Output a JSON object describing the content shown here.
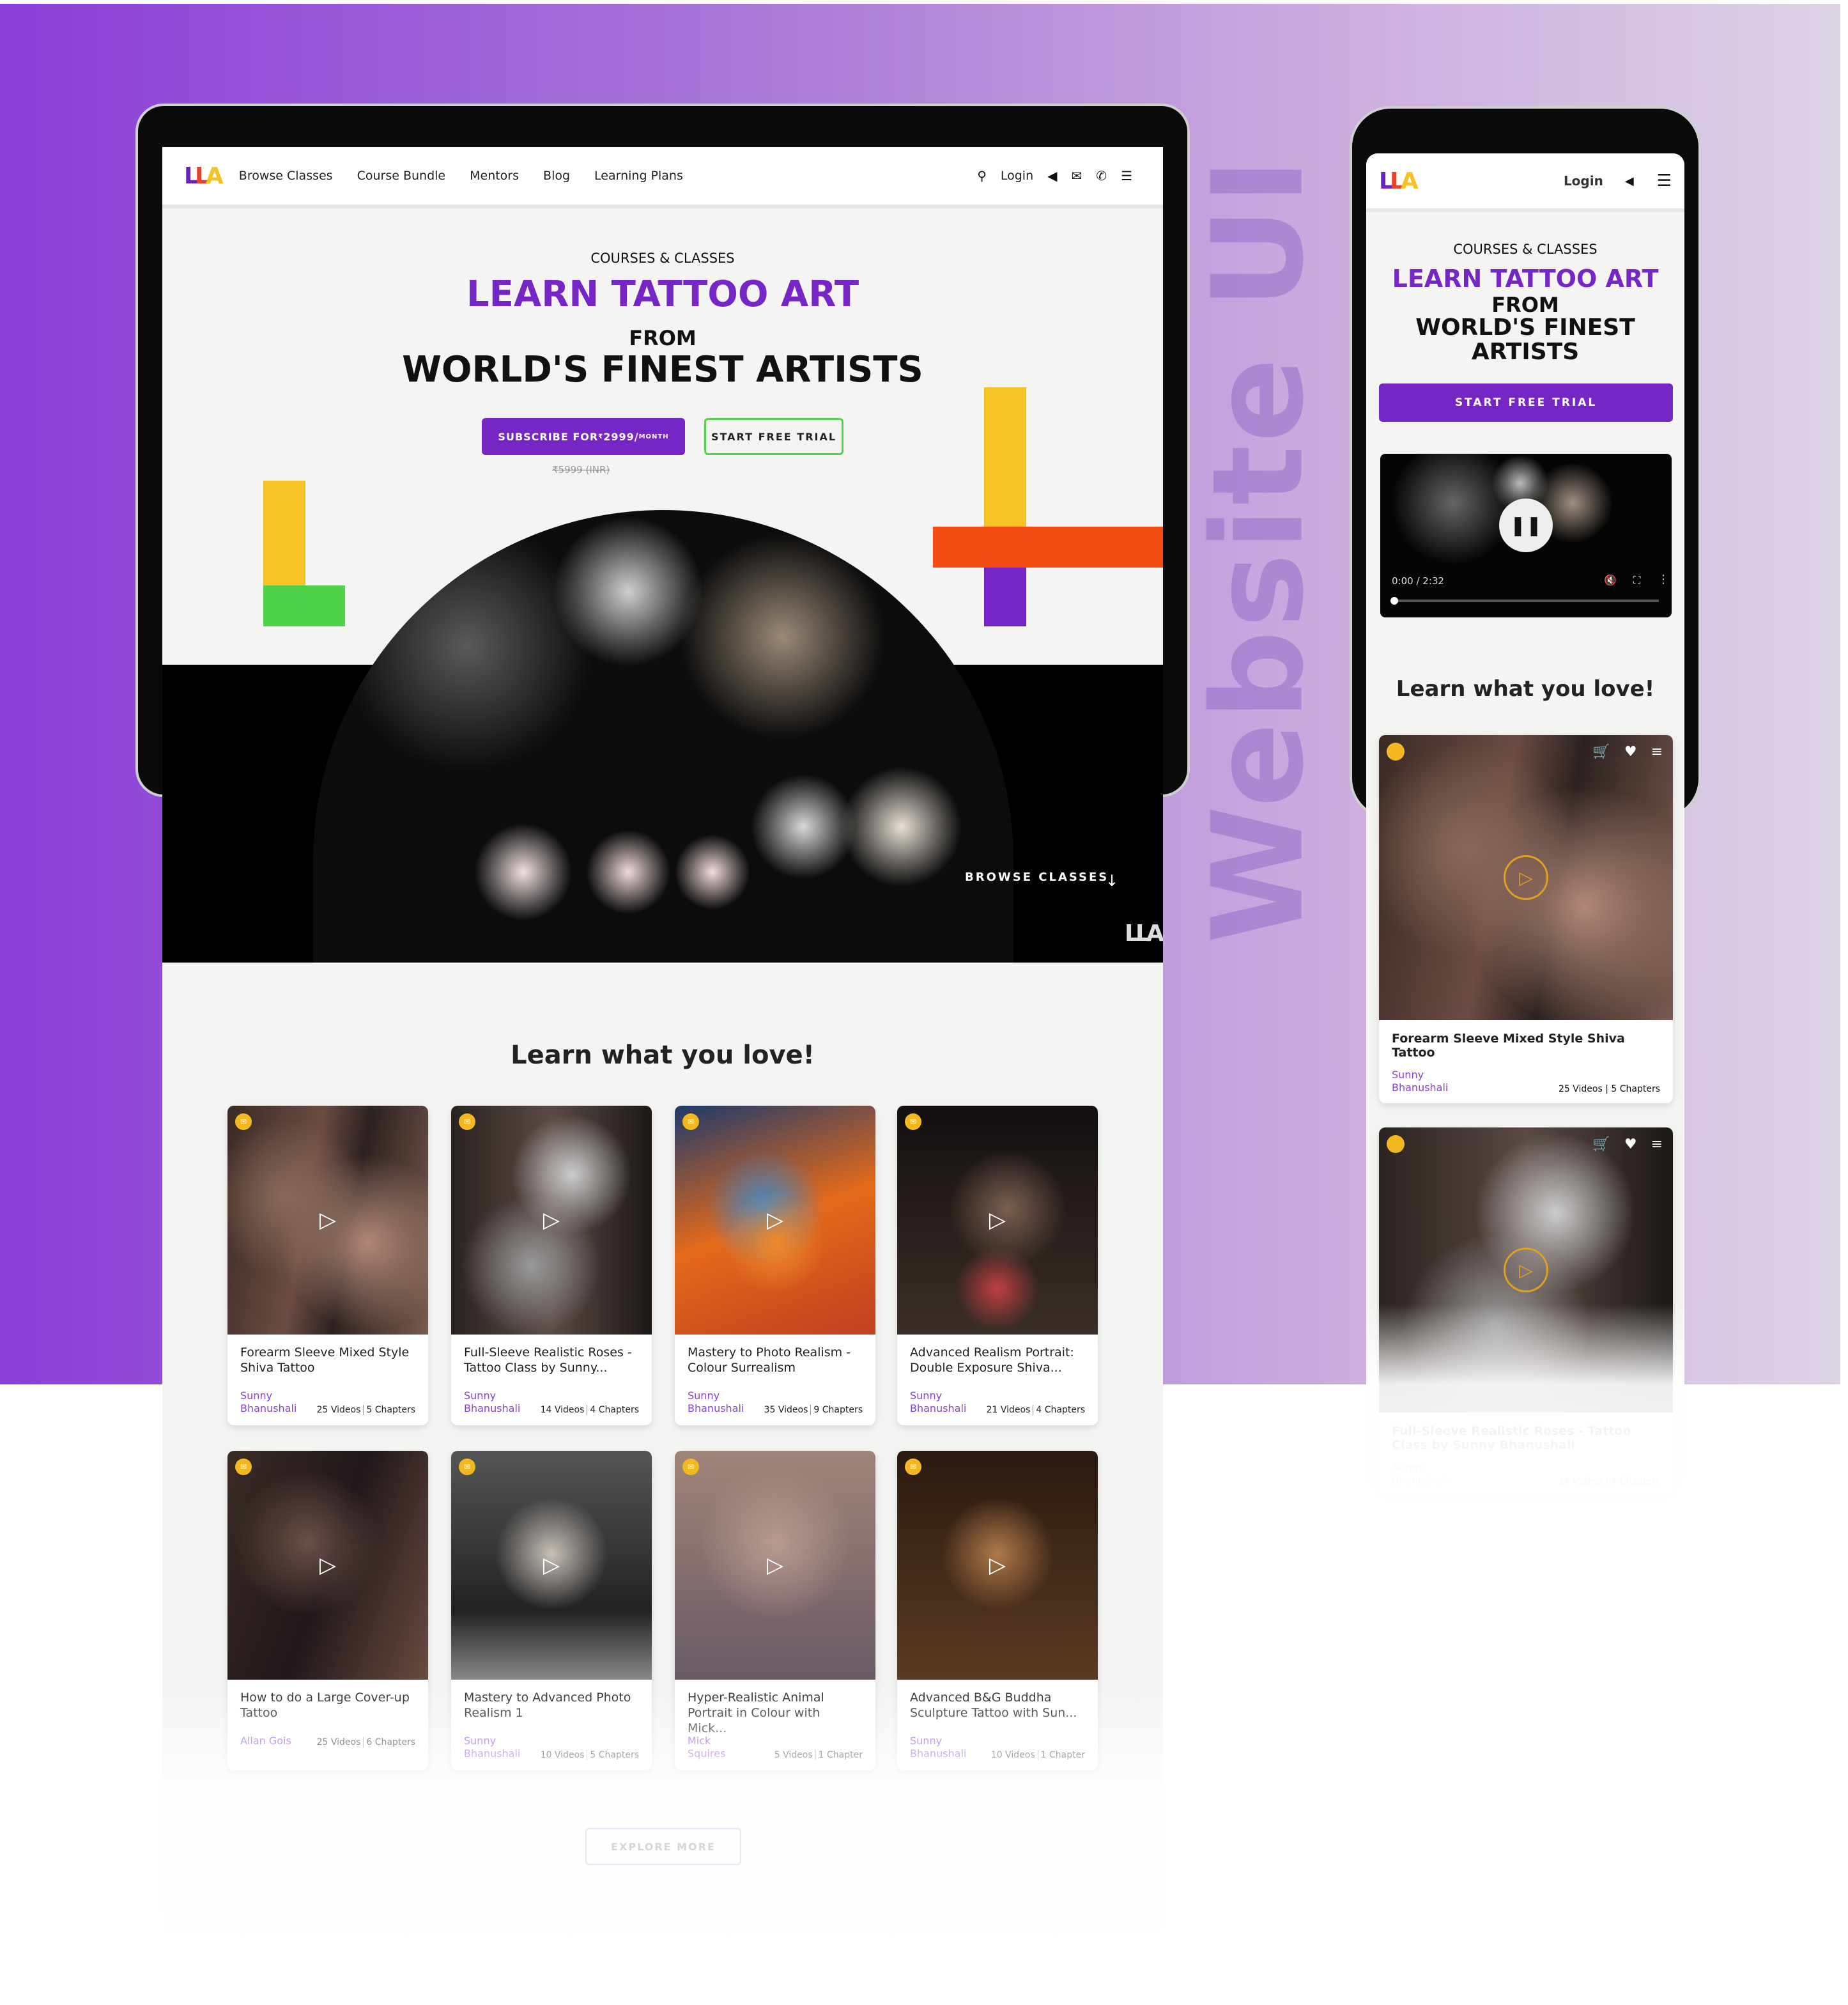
{
  "decor": {
    "side_title": "Website UI",
    "colors": {
      "purple": "#7526c4",
      "yellow": "#f5c326",
      "green": "#4fd14a",
      "orange": "#f44d12"
    }
  },
  "desktop": {
    "nav": {
      "logo": "LLA",
      "links": [
        "Browse Classes",
        "Course Bundle",
        "Mentors",
        "Blog",
        "Learning Plans"
      ],
      "login": "Login",
      "icons": [
        "search-icon",
        "megaphone-icon",
        "mail-icon",
        "phone-icon",
        "menu-icon"
      ]
    },
    "hero": {
      "eyebrow": "COURSES & CLASSES",
      "title": "LEARN TATTOO ART",
      "from": "FROM",
      "subtitle": "WORLD'S FINEST ARTISTS",
      "subscribe_prefix": "SUBSCRIBE FOR ",
      "subscribe_currency": "₹",
      "subscribe_price": "2999/",
      "subscribe_period": "MONTH",
      "trial": "START FREE TRIAL",
      "old_price": "₹5999 (INR)",
      "browse": "BROWSE CLASSES",
      "watermark": "LLA"
    },
    "section_title": "Learn what you love!",
    "courses": [
      {
        "title": "Forearm Sleeve Mixed Style Shiva Tattoo",
        "author": "Sunny Bhanushali",
        "videos": "25 Videos",
        "chapters": "5 Chapters"
      },
      {
        "title": "Full-Sleeve Realistic Roses - Tattoo Class by Sunny...",
        "author": "Sunny Bhanushali",
        "videos": "14 Videos",
        "chapters": "4 Chapters"
      },
      {
        "title": "Mastery to Photo Realism - Colour Surrealism",
        "author": "Sunny Bhanushali",
        "videos": "35 Videos",
        "chapters": "9 Chapters"
      },
      {
        "title": "Advanced Realism Portrait: Double Exposure Shiva...",
        "author": "Sunny Bhanushali",
        "videos": "21 Videos",
        "chapters": "4 Chapters"
      },
      {
        "title": "How to do a Large Cover-up Tattoo",
        "author": "Allan Gois",
        "videos": "25 Videos",
        "chapters": "6 Chapters"
      },
      {
        "title": "Mastery to Advanced Photo Realism 1",
        "author": "Sunny Bhanushali",
        "videos": "10 Videos",
        "chapters": "5 Chapters"
      },
      {
        "title": "Hyper-Realistic Animal Portrait in Colour with Mick...",
        "author": "Mick Squires",
        "videos": "5 Videos",
        "chapters": "1 Chapter"
      },
      {
        "title": "Advanced B&G Buddha Sculpture Tattoo with Sun...",
        "author": "Sunny Bhanushali",
        "videos": "10 Videos",
        "chapters": "1 Chapter"
      }
    ],
    "explore": "EXPLORE MORE"
  },
  "mobile": {
    "nav": {
      "logo": "LLA",
      "login": "Login",
      "icons": [
        "megaphone-icon",
        "menu-icon"
      ]
    },
    "hero": {
      "eyebrow": "COURSES & CLASSES",
      "title": "LEARN TATTOO ART",
      "from": "FROM",
      "line2": "WORLD'S FINEST",
      "line3": "ARTISTS",
      "trial": "START FREE TRIAL"
    },
    "video": {
      "time": "0:00 / 2:32",
      "progress": 0.02,
      "state": "playing"
    },
    "section_title": "Learn what you love!",
    "courses": [
      {
        "title": "Forearm Sleeve Mixed Style Shiva Tattoo",
        "author": "Sunny Bhanushali",
        "videos": "25 Videos",
        "chapters": "5 Chapters"
      },
      {
        "title": "Full-Sleeve Realistic Roses - Tattoo Class by Sunny Bhanushali",
        "author": "Sunny Bhanushali",
        "videos": "14 Videos",
        "chapters": "4 Chapters"
      }
    ]
  }
}
